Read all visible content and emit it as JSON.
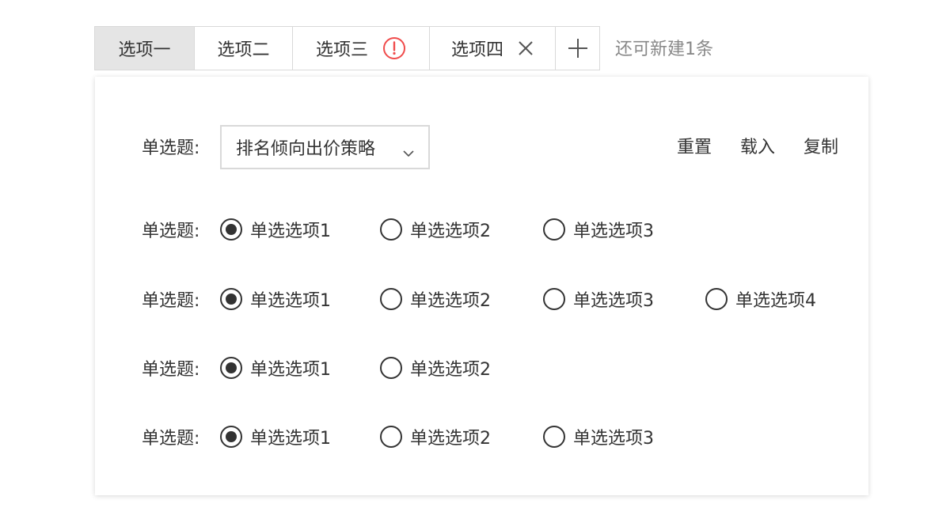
{
  "tabs": [
    {
      "label": "选项一",
      "active": true
    },
    {
      "label": "选项二",
      "active": false
    },
    {
      "label": "选项三",
      "status_icon": "warning-circle-icon"
    },
    {
      "label": "选项四",
      "close_icon": "close-icon"
    }
  ],
  "add_tab_icon": "plus-icon",
  "remaining_text": "还可新建1条",
  "colors": {
    "warning": "#f04b4b",
    "active_tab_bg": "#e5e5e5",
    "border": "#d9d9d9"
  },
  "form": {
    "select_row": {
      "label": "单选题:",
      "selected_value": "排名倾向出价策略",
      "chevron_icon": "chevron-down-icon"
    },
    "actions": {
      "reset": "重置",
      "load": "载入",
      "copy": "复制"
    },
    "radio_groups": [
      {
        "label": "单选题:",
        "selected_index": 0,
        "options": [
          "单选选项1",
          "单选选项2",
          "单选选项3"
        ]
      },
      {
        "label": "单选题:",
        "selected_index": 0,
        "options": [
          "单选选项1",
          "单选选项2",
          "单选选项3",
          "单选选项4"
        ]
      },
      {
        "label": "单选题:",
        "selected_index": 0,
        "options": [
          "单选选项1",
          "单选选项2"
        ]
      },
      {
        "label": "单选题:",
        "selected_index": 0,
        "options": [
          "单选选项1",
          "单选选项2",
          "单选选项3"
        ]
      }
    ]
  }
}
